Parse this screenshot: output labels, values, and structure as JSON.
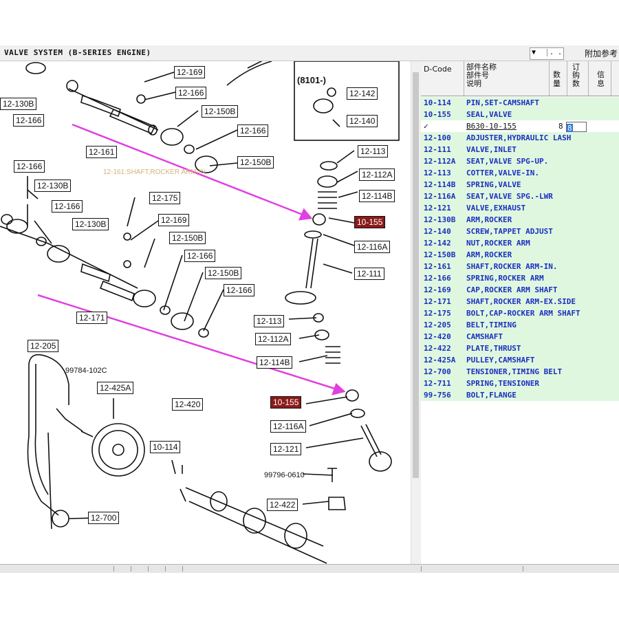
{
  "window": {
    "title": "VALVE SYSTEM (B-SERIES ENGINE)",
    "reference_label": "附加参考",
    "combo_arrow": "▼",
    "combo_dots": ". .",
    "tooltip": "12-161:SHAFT,ROCKER ARM-IN."
  },
  "diagram": {
    "labels": [
      {
        "id": "l1",
        "text": "12-169"
      },
      {
        "id": "l2",
        "text": "12-166"
      },
      {
        "id": "l3",
        "text": "12-150B"
      },
      {
        "id": "l4",
        "text": "12-166"
      },
      {
        "id": "l5",
        "text": "12-150B"
      },
      {
        "id": "l6",
        "text": "12-130B"
      },
      {
        "id": "l7",
        "text": "12-166"
      },
      {
        "id": "l8",
        "text": "12-161"
      },
      {
        "id": "l9",
        "text": "12-166"
      },
      {
        "id": "l10",
        "text": "12-130B"
      },
      {
        "id": "l11",
        "text": "12-166"
      },
      {
        "id": "l12",
        "text": "12-130B"
      },
      {
        "id": "l13",
        "text": "12-175"
      },
      {
        "id": "l14",
        "text": "12-169"
      },
      {
        "id": "l15",
        "text": "12-150B"
      },
      {
        "id": "l16",
        "text": "12-166"
      },
      {
        "id": "l17",
        "text": "12-150B"
      },
      {
        "id": "l18",
        "text": "12-166"
      },
      {
        "id": "l19",
        "text": "12-171"
      },
      {
        "id": "l20",
        "text": "12-142"
      },
      {
        "id": "l21",
        "text": "12-140"
      },
      {
        "id": "l22",
        "text": "12-113"
      },
      {
        "id": "l23",
        "text": "12-112A"
      },
      {
        "id": "l24",
        "text": "12-114B"
      },
      {
        "id": "l25",
        "text": "10-155"
      },
      {
        "id": "l26",
        "text": "12-116A"
      },
      {
        "id": "l27",
        "text": "12-111"
      },
      {
        "id": "l28",
        "text": "12-113"
      },
      {
        "id": "l29",
        "text": "12-112A"
      },
      {
        "id": "l30",
        "text": "12-114B"
      },
      {
        "id": "l31",
        "text": "12-205"
      },
      {
        "id": "l32",
        "text": "12-425A"
      },
      {
        "id": "l33",
        "text": "12-420"
      },
      {
        "id": "l34",
        "text": "10-114"
      },
      {
        "id": "l35",
        "text": "10-155"
      },
      {
        "id": "l36",
        "text": "12-116A"
      },
      {
        "id": "l37",
        "text": "12-121"
      },
      {
        "id": "l38",
        "text": "12-422"
      },
      {
        "id": "l39",
        "text": "12-700"
      }
    ],
    "inset_label": "(8101-)",
    "part_no_a": "99784-102C",
    "part_no_b": "99796-0610"
  },
  "table": {
    "headers": {
      "code": "D-Code",
      "name_l1": "部件名称",
      "name_l2": "部件号",
      "name_l3": "说明",
      "qty_l1": "数",
      "qty_l2": "量",
      "order_l1": "订",
      "order_l2": "购",
      "order_l3": "数",
      "info_l1": "信",
      "info_l2": "息"
    },
    "rows": [
      {
        "code": "10-114",
        "name": "PIN,SET-CAMSHAFT",
        "style": "green"
      },
      {
        "code": "10-155",
        "name": "SEAL,VALVE",
        "style": "green"
      },
      {
        "code": "✓",
        "name": "B630-10-155",
        "qty": "8",
        "order": "8",
        "style": "white"
      },
      {
        "code": "12-100",
        "name": "ADJUSTER,HYDRAULIC LASH",
        "style": "green"
      },
      {
        "code": "12-111",
        "name": "VALVE,INLET",
        "style": "green"
      },
      {
        "code": "12-112A",
        "name": "SEAT,VALVE SPG-UP.",
        "style": "green"
      },
      {
        "code": "12-113",
        "name": "COTTER,VALVE-IN.",
        "style": "green"
      },
      {
        "code": "12-114B",
        "name": "SPRING,VALVE",
        "style": "green"
      },
      {
        "code": "12-116A",
        "name": "SEAT,VALVE SPG.-LWR",
        "style": "green"
      },
      {
        "code": "12-121",
        "name": "VALVE,EXHAUST",
        "style": "green"
      },
      {
        "code": "12-130B",
        "name": "ARM,ROCKER",
        "style": "green"
      },
      {
        "code": "12-140",
        "name": "SCREW,TAPPET ADJUST",
        "style": "green"
      },
      {
        "code": "12-142",
        "name": "NUT,ROCKER ARM",
        "style": "green"
      },
      {
        "code": "12-150B",
        "name": "ARM,ROCKER",
        "style": "green"
      },
      {
        "code": "12-161",
        "name": "SHAFT,ROCKER ARM-IN.",
        "style": "green"
      },
      {
        "code": "12-166",
        "name": "SPRING,ROCKER ARM",
        "style": "green"
      },
      {
        "code": "12-169",
        "name": "CAP,ROCKER ARM SHAFT",
        "style": "green"
      },
      {
        "code": "12-171",
        "name": "SHAFT,ROCKER ARM-EX.SIDE",
        "style": "green"
      },
      {
        "code": "12-175",
        "name": "BOLT,CAP-ROCKER ARM SHAFT",
        "style": "green"
      },
      {
        "code": "12-205",
        "name": "BELT,TIMING",
        "style": "green"
      },
      {
        "code": "12-420",
        "name": "CAMSHAFT",
        "style": "green"
      },
      {
        "code": "12-422",
        "name": "PLATE,THRUST",
        "style": "green"
      },
      {
        "code": "12-425A",
        "name": "PULLEY,CAMSHAFT",
        "style": "green"
      },
      {
        "code": "12-700",
        "name": "TENSIONER,TIMING BELT",
        "style": "green"
      },
      {
        "code": "12-711",
        "name": "SPRING,TENSIONER",
        "style": "green"
      },
      {
        "code": "99-756",
        "name": "BOLT,FLANGE",
        "style": "green"
      }
    ]
  },
  "colors": {
    "row_green": "#dff7df",
    "row_text_blue": "#1a2fc0",
    "highlight_label": "#8b1a1a",
    "arrow_magenta": "#e040e0"
  }
}
